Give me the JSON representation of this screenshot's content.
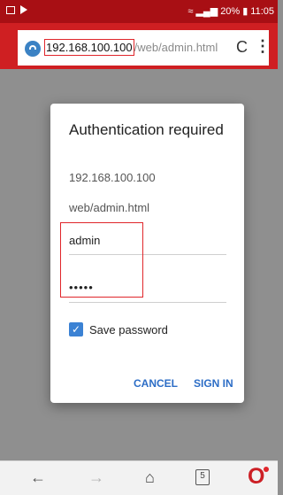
{
  "status_bar": {
    "battery": "20%",
    "time": "11:05"
  },
  "address_bar": {
    "url_host": "192.168.100.100",
    "url_path": "/web/admin.html"
  },
  "dialog": {
    "title": "Authentication required",
    "host": "192.168.100.100",
    "path": "web/admin.html",
    "username": "admin",
    "password_mask": "•••••",
    "save_password_label": "Save password",
    "save_password_checked": true,
    "cancel_label": "CANCEL",
    "signin_label": "SIGN IN"
  },
  "bottom_bar": {
    "tab_count": "5"
  },
  "colors": {
    "status_bar": "#a80f14",
    "address_bar": "#cf1f22",
    "highlight_box": "#e0262b",
    "button_text": "#2c6dc6"
  }
}
